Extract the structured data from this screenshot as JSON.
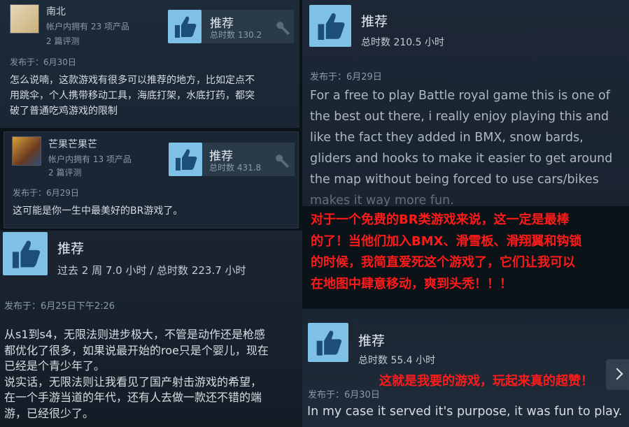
{
  "review1": {
    "username": "南北",
    "products": "帐户内拥有 23 项产品",
    "reviews": "2 篇评测",
    "verdict": "推荐",
    "hours": "总时数 130.2",
    "posted": "发布于：6月30日",
    "body": [
      "怎么说喃，这款游戏有很多可以推荐的地方，比如定点不",
      "用跳伞，个人携带移动工具，海底打架，水底打药，都突",
      "破了普通吃鸡游戏的限制"
    ]
  },
  "review2": {
    "username": "芒果芒果芒",
    "products": "帐户内拥有 13 项产品",
    "reviews": "2 篇评测",
    "verdict": "推荐",
    "hours": "总时数 431.8",
    "posted": "发布于：6月29日",
    "body": [
      "这可能是你一生中最美好的BR游戏了。"
    ]
  },
  "review3": {
    "verdict": "推荐",
    "hours": "过去 2 周 7.0 小时 / 总时数 223.7 小时",
    "posted": "发布于：6月25日下午2:26",
    "body": [
      "从s1到s4，无限法则进步极大，不管是动作还是枪感",
      "都优化了很多，如果说最开始的roe只是个婴儿，现在",
      "已经是个青少年了。",
      "说实话，无限法则让我看见了国产射击游戏的希望，",
      "在一个手游当道的年代，还有人去做一款还不错的端",
      "游，已经很少了。"
    ]
  },
  "review4": {
    "verdict": "推荐",
    "hours": "总时数 210.5 小时",
    "posted": "发布于：6月29日",
    "body": [
      "For a free to play Battle royal game this is one of",
      "the best out there, i really enjoy playing this and",
      "like the fact they added in BMX, snow bards,",
      "gliders and hooks to make it easier to get around",
      "the map without being forced to use cars/bikes",
      "makes it way more fun."
    ],
    "translation": [
      "对于一个免费的BR类游戏来说，这一定是最棒",
      "的了！当他们加入BMX、滑雪板、滑翔翼和钩锁",
      "的时候，我简直爱死这个游戏了，它们让我可以",
      "在地图中肆意移动，爽到头秃！！！"
    ]
  },
  "review5": {
    "verdict": "推荐",
    "hours": "总时数 55.4 小时",
    "posted": "发布于：6月30日",
    "translation": "这就是我要的游戏，玩起来真的超赞！",
    "body": "In my case it served it's purpose, it was fun to play."
  },
  "colors": {
    "thumb": "#7fc0e6",
    "red_text": "#ff1a1a"
  },
  "icons": [
    "thumbs-up-icon",
    "key-icon",
    "chevron-right-icon"
  ]
}
